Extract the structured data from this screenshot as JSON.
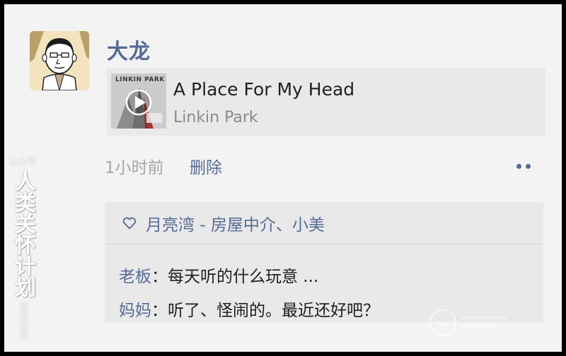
{
  "post": {
    "author": "大龙",
    "music": {
      "title": "A Place For My Head",
      "artist": "Linkin Park",
      "cover_text": "LINKIN PARK"
    },
    "time": "1小时前",
    "delete_label": "删除",
    "more_icon": "ellipsis-icon"
  },
  "likes": {
    "icon": "heart-icon",
    "names": "月亮湾 - 房屋中介、小美"
  },
  "comments": [
    {
      "author": "老板",
      "sep": "：",
      "text": "每天听的什么玩意 ..."
    },
    {
      "author": "妈妈",
      "sep": "：",
      "text": "听了、怪闹的。最近还好吧？"
    }
  ],
  "watermark": {
    "top": "公众号",
    "main": "人类关怀计划",
    "bottom": "原创出品"
  },
  "colors": {
    "link": "#576b95",
    "background": "#f3f3f3",
    "card": "#e9e9ea"
  }
}
